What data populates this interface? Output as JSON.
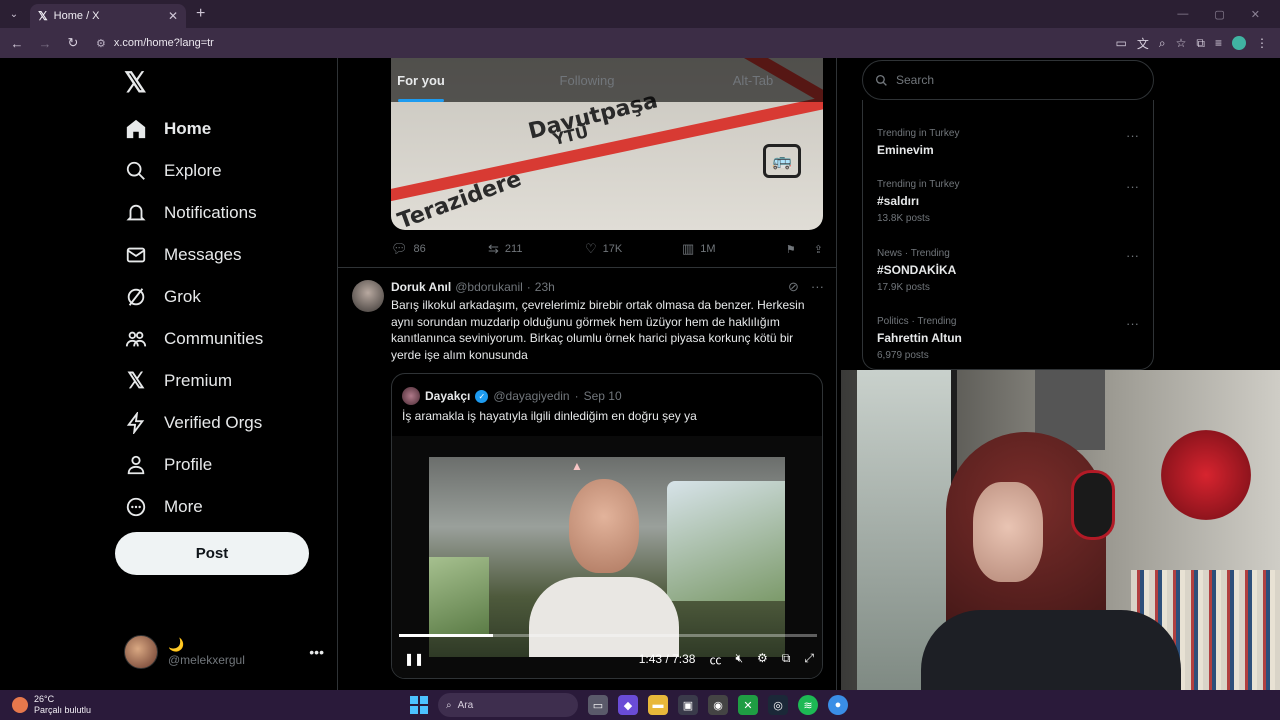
{
  "browser": {
    "tab_title": "Home / X",
    "url": "x.com/home?lang=tr"
  },
  "sidebar": {
    "logo": "𝕏",
    "items": [
      {
        "label": "Home",
        "icon": "home-icon"
      },
      {
        "label": "Explore",
        "icon": "search-icon"
      },
      {
        "label": "Notifications",
        "icon": "bell-icon"
      },
      {
        "label": "Messages",
        "icon": "mail-icon"
      },
      {
        "label": "Grok",
        "icon": "grok-icon"
      },
      {
        "label": "Communities",
        "icon": "communities-icon"
      },
      {
        "label": "Premium",
        "icon": "x-icon"
      },
      {
        "label": "Verified Orgs",
        "icon": "bolt-icon"
      },
      {
        "label": "Profile",
        "icon": "person-icon"
      },
      {
        "label": "More",
        "icon": "more-circle-icon"
      }
    ],
    "post_label": "Post",
    "account": {
      "name": "🌙",
      "handle": "@melekxergul"
    }
  },
  "feed": {
    "tabs": [
      "For you",
      "Following",
      "Alt-Tab"
    ],
    "image_post": {
      "map_labels": [
        "Davutpaşa",
        "YTÜ",
        "Terazidere"
      ],
      "stats": {
        "replies": "86",
        "reposts": "211",
        "likes": "17K",
        "views": "1M"
      }
    },
    "tweet": {
      "name": "Doruk Anıl",
      "handle": "@bdorukanil",
      "time": "23h",
      "text": "Barış ilkokul arkadaşım, çevrelerimiz birebir ortak olmasa da benzer. Herkesin aynı sorundan muzdarip olduğunu görmek hem üzüyor hem de haklılığım kanıtlanınca seviniyorum. Birkaç olumlu örnek harici piyasa korkunç kötü bir yerde işe alım konusunda",
      "quote": {
        "name": "Dayakçı",
        "handle": "@dayagiyedin",
        "date": "Sep 10",
        "text": "İş aramakla iş hayatıyla ilgili dinlediğim en doğru şey ya",
        "video": {
          "time": "1:43 / 7:38",
          "progress": 0.225
        }
      }
    }
  },
  "right": {
    "search_placeholder": "Search",
    "trends": [
      {
        "category": "Trending in Turkey",
        "name": "Eminevim",
        "count": ""
      },
      {
        "category": "Trending in Turkey",
        "name": "#saldırı",
        "count": "13.8K posts"
      },
      {
        "category": "News · Trending",
        "name": "#SONDAKİKA",
        "count": "17.9K posts"
      },
      {
        "category": "Politics · Trending",
        "name": "Fahrettin Altun",
        "count": "6,979 posts"
      }
    ]
  },
  "taskbar": {
    "weather_temp": "26°C",
    "weather_desc": "Parçalı bulutlu",
    "search_label": "Ara"
  }
}
